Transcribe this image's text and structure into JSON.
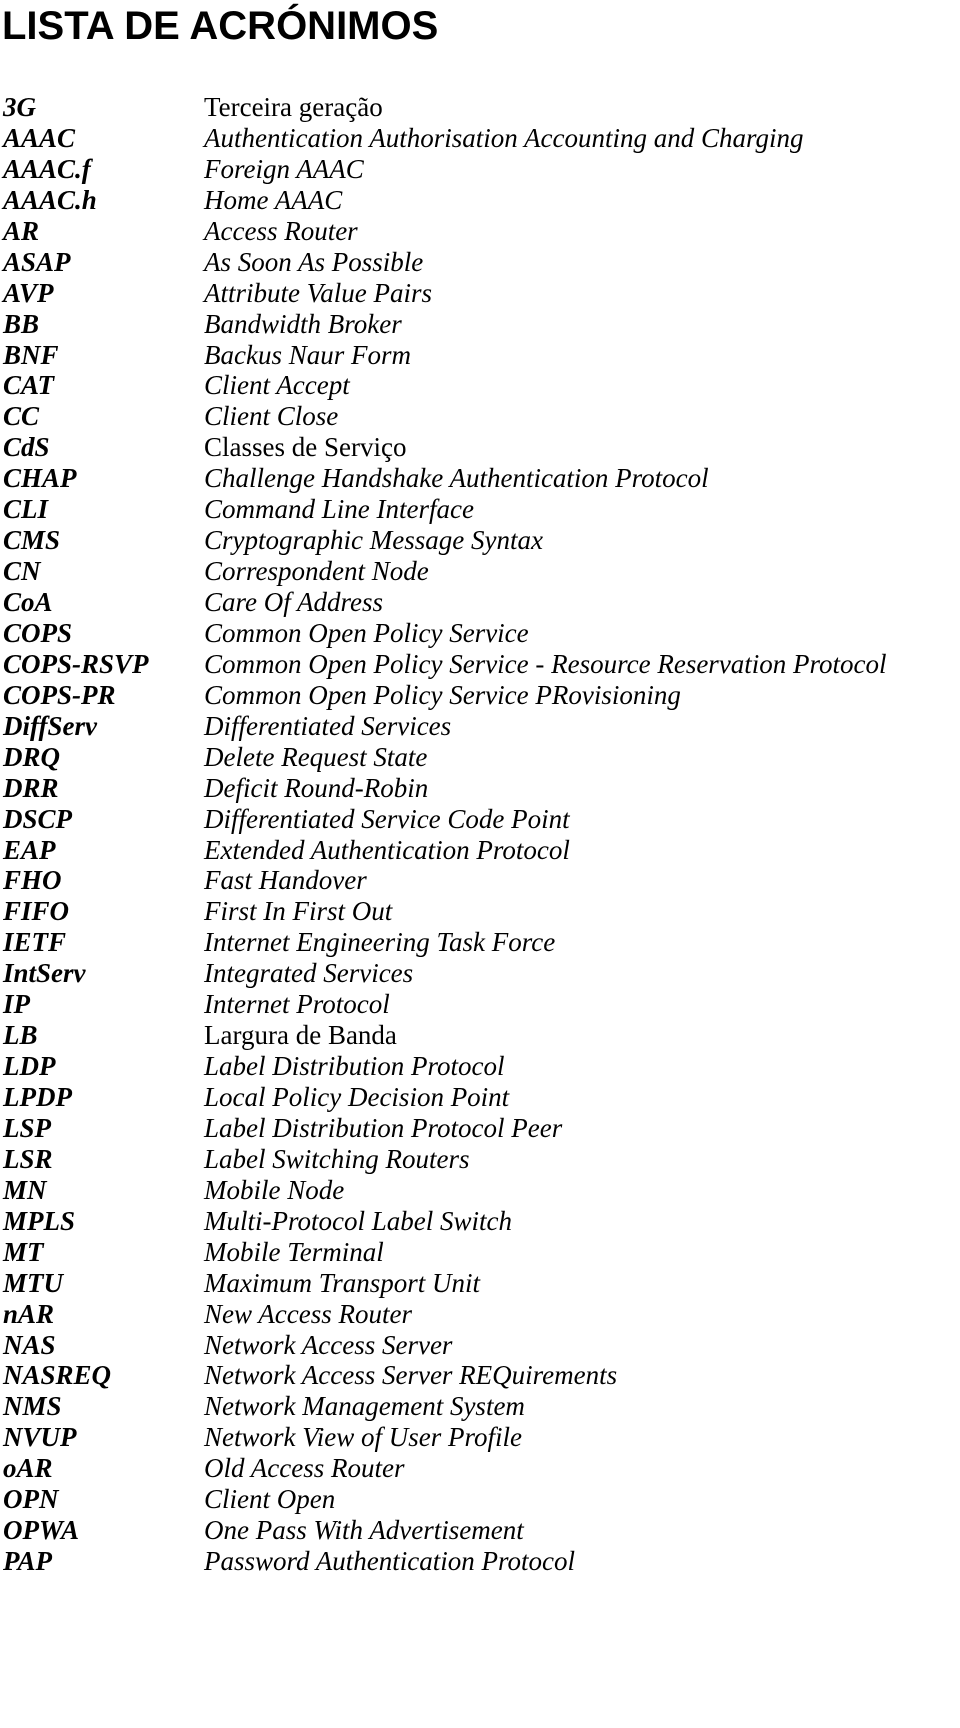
{
  "page": {
    "title": "LISTA DE ACRÓNIMOS"
  },
  "acronyms": [
    {
      "acronym": "3G",
      "meaning": "Terceira geração",
      "upright": true
    },
    {
      "acronym": "AAAC",
      "meaning": "Authentication Authorisation Accounting and Charging"
    },
    {
      "acronym": "AAAC.f",
      "meaning": "Foreign AAAC"
    },
    {
      "acronym": "AAAC.h",
      "meaning": "Home AAAC"
    },
    {
      "acronym": "AR",
      "meaning": "Access Router"
    },
    {
      "acronym": "ASAP",
      "meaning": "As Soon As Possible"
    },
    {
      "acronym": "AVP",
      "meaning": "Attribute Value Pairs"
    },
    {
      "acronym": "BB",
      "meaning": "Bandwidth Broker"
    },
    {
      "acronym": "BNF",
      "meaning": "Backus Naur Form"
    },
    {
      "acronym": "CAT",
      "meaning": "Client Accept"
    },
    {
      "acronym": "CC",
      "meaning": "Client Close"
    },
    {
      "acronym": "CdS",
      "meaning": "Classes de Serviço",
      "upright": true
    },
    {
      "acronym": "CHAP",
      "meaning": "Challenge Handshake Authentication Protocol"
    },
    {
      "acronym": "CLI",
      "meaning": "Command Line Interface"
    },
    {
      "acronym": "CMS",
      "meaning": "Cryptographic Message Syntax"
    },
    {
      "acronym": "CN",
      "meaning": "Correspondent Node"
    },
    {
      "acronym": "CoA",
      "meaning": "Care Of Address"
    },
    {
      "acronym": "COPS",
      "meaning": "Common Open Policy Service"
    },
    {
      "acronym": "COPS-RSVP",
      "meaning": "Common Open Policy Service - Resource Reservation Protocol"
    },
    {
      "acronym": "COPS-PR",
      "meaning": "Common Open Policy Service PRovisioning"
    },
    {
      "acronym": "DiffServ",
      "meaning": "Differentiated Services"
    },
    {
      "acronym": "DRQ",
      "meaning": "Delete Request State"
    },
    {
      "acronym": "DRR",
      "meaning": "Deficit Round-Robin"
    },
    {
      "acronym": "DSCP",
      "meaning": "Differentiated Service Code Point"
    },
    {
      "acronym": "EAP",
      "meaning": "Extended Authentication Protocol"
    },
    {
      "acronym": "FHO",
      "meaning": "Fast Handover"
    },
    {
      "acronym": "FIFO",
      "meaning": "First In First Out"
    },
    {
      "acronym": "IETF",
      "meaning": "Internet Engineering Task Force"
    },
    {
      "acronym": "IntServ",
      "meaning": "Integrated Services"
    },
    {
      "acronym": "IP",
      "meaning": "Internet Protocol"
    },
    {
      "acronym": "LB",
      "meaning": "Largura de Banda",
      "upright": true
    },
    {
      "acronym": "LDP",
      "meaning": "Label Distribution Protocol"
    },
    {
      "acronym": "LPDP",
      "meaning": "Local Policy Decision Point"
    },
    {
      "acronym": "LSP",
      "meaning": "Label Distribution Protocol Peer"
    },
    {
      "acronym": "LSR",
      "meaning": "Label Switching Routers"
    },
    {
      "acronym": "MN",
      "meaning": "Mobile Node"
    },
    {
      "acronym": "MPLS",
      "meaning": "Multi-Protocol Label Switch"
    },
    {
      "acronym": "MT",
      "meaning": "Mobile Terminal"
    },
    {
      "acronym": "MTU",
      "meaning": "Maximum Transport Unit"
    },
    {
      "acronym": "nAR",
      "meaning": "New Access Router"
    },
    {
      "acronym": "NAS",
      "meaning": "Network Access Server"
    },
    {
      "acronym": "NASREQ",
      "meaning": "Network Access Server REQuirements"
    },
    {
      "acronym": "NMS",
      "meaning": "Network Management System"
    },
    {
      "acronym": "NVUP",
      "meaning": "Network View of User Profile"
    },
    {
      "acronym": "oAR",
      "meaning": "Old Access Router"
    },
    {
      "acronym": "OPN",
      "meaning": "Client Open"
    },
    {
      "acronym": "OPWA",
      "meaning": "One Pass With Advertisement"
    },
    {
      "acronym": "PAP",
      "meaning": "Password Authentication Protocol"
    }
  ]
}
